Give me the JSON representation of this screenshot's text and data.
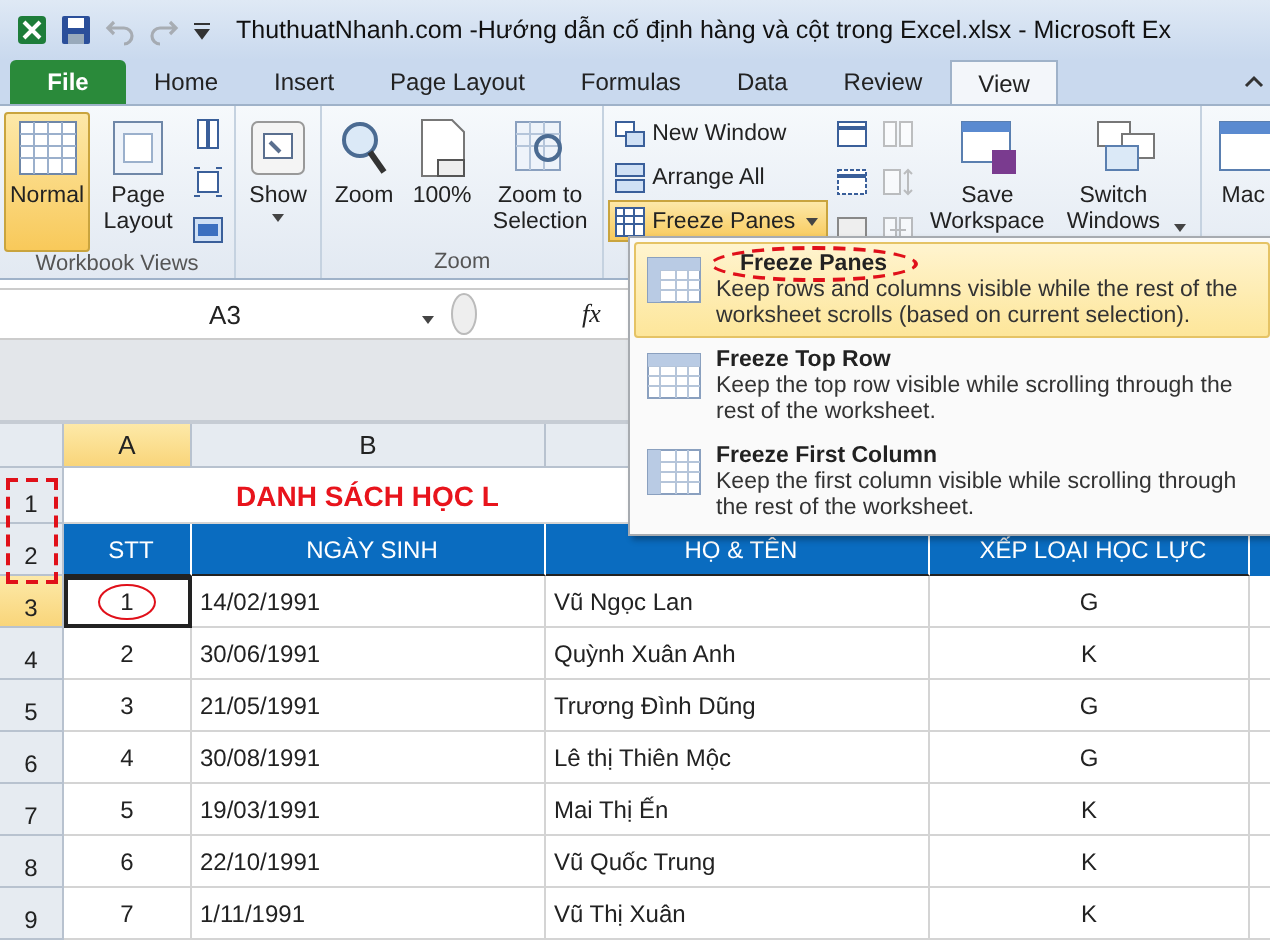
{
  "window": {
    "title": "ThuthuatNhanh.com -Hướng dẫn cố định hàng và cột trong Excel.xlsx  -  Microsoft Ex"
  },
  "tabs": [
    {
      "label": "File",
      "kind": "file",
      "selected": false
    },
    {
      "label": "Home",
      "kind": "tab",
      "selected": false
    },
    {
      "label": "Insert",
      "kind": "tab",
      "selected": false
    },
    {
      "label": "Page Layout",
      "kind": "tab",
      "selected": false
    },
    {
      "label": "Formulas",
      "kind": "tab",
      "selected": false
    },
    {
      "label": "Data",
      "kind": "tab",
      "selected": false
    },
    {
      "label": "Review",
      "kind": "tab",
      "selected": false
    },
    {
      "label": "View",
      "kind": "tab",
      "selected": true
    }
  ],
  "ribbon": {
    "workbook_views": {
      "label": "Workbook Views",
      "normal": {
        "label": "Normal",
        "selected": true
      },
      "page_layout": "Page Layout"
    },
    "show": "Show",
    "zoom": {
      "label": "Zoom",
      "buttons": [
        "Zoom",
        "100%",
        "Zoom to Selection"
      ]
    },
    "window": {
      "new_window": "New Window",
      "arrange_all": "Arrange All",
      "freeze_panes": {
        "label": "Freeze Panes",
        "pressed": true
      },
      "save_workspace": "Save Workspace",
      "switch_windows": "Switch Windows"
    },
    "macros": "Mac"
  },
  "formula_bar": {
    "name_box": "A3",
    "fx": "fx"
  },
  "freeze_menu": [
    {
      "title": "Freeze Panes",
      "description": "Keep rows and columns visible while the rest of the worksheet scrolls (based on current selection).",
      "selected": true
    },
    {
      "title": "Freeze Top Row",
      "description": "Keep the top row visible while scrolling through the rest of the worksheet.",
      "selected": false
    },
    {
      "title": "Freeze First Column",
      "description": "Keep the first column visible while scrolling through the rest of the worksheet.",
      "selected": false
    }
  ],
  "sheet": {
    "columns": [
      {
        "label": "A",
        "selected": true
      },
      {
        "label": "B",
        "selected": false
      }
    ],
    "title": "DANH SÁCH HỌC L",
    "header_row": "2",
    "title_row": "1",
    "headers": [
      "STT",
      "NGÀY SINH",
      "HỌ & TÊN",
      "XẾP LOẠI HỌC LỰC"
    ],
    "rows": [
      {
        "row": "3",
        "selected": true,
        "cells": [
          "1",
          "14/02/1991",
          "Vũ Ngọc Lan",
          "G"
        ]
      },
      {
        "row": "4",
        "selected": false,
        "cells": [
          "2",
          "30/06/1991",
          "Quỳnh Xuân Anh",
          "K"
        ]
      },
      {
        "row": "5",
        "selected": false,
        "cells": [
          "3",
          "21/05/1991",
          "Trương Đình Dũng",
          "G"
        ]
      },
      {
        "row": "6",
        "selected": false,
        "cells": [
          "4",
          "30/08/1991",
          "Lê thị Thiên Mộc",
          "G"
        ]
      },
      {
        "row": "7",
        "selected": false,
        "cells": [
          "5",
          "19/03/1991",
          "Mai Thị Ến",
          "K"
        ]
      },
      {
        "row": "8",
        "selected": false,
        "cells": [
          "6",
          "22/10/1991",
          "Vũ Quốc Trung",
          "K"
        ]
      },
      {
        "row": "9",
        "selected": false,
        "cells": [
          "7",
          "1/11/1991",
          "Vũ Thị Xuân",
          "K"
        ]
      }
    ]
  }
}
